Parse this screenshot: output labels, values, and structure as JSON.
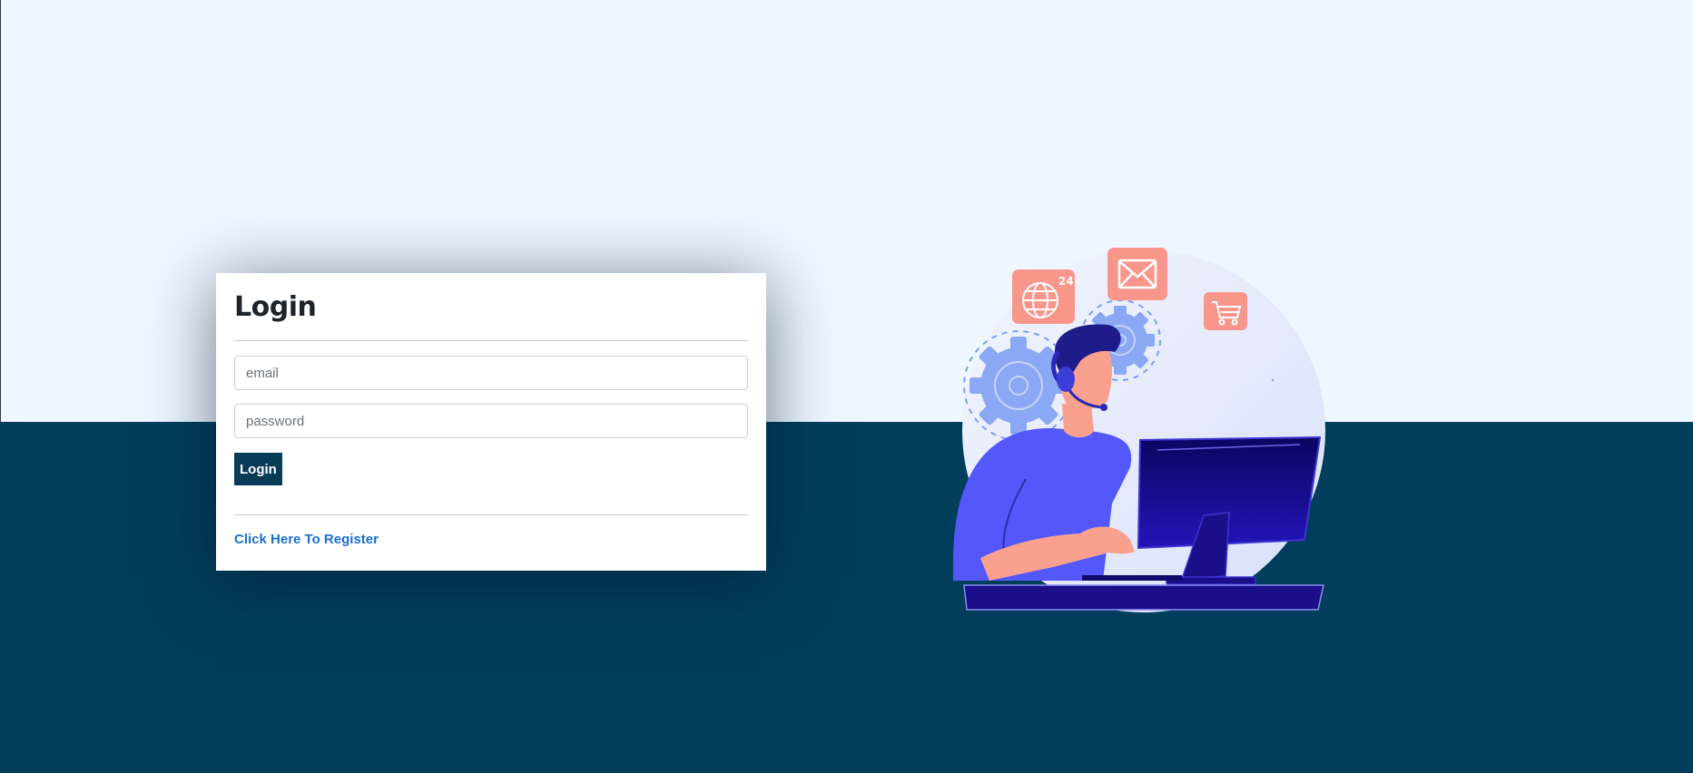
{
  "login_card": {
    "title": "Login",
    "email_placeholder": "email",
    "password_placeholder": "password",
    "login_button_label": "Login",
    "register_link_label": "Click Here To Register"
  },
  "illustration": {
    "globe_badge_text": "24",
    "icons": [
      "globe-icon",
      "mail-icon",
      "cart-icon",
      "gear-icon"
    ],
    "colors": {
      "background_light": "#eef6ff",
      "background_dark": "#013e5c",
      "button": "#073b57",
      "link": "#1a6fcf",
      "icon_tiles": "#f9968b",
      "person_shirt": "#5458fb",
      "monitor": "#13087a"
    }
  }
}
